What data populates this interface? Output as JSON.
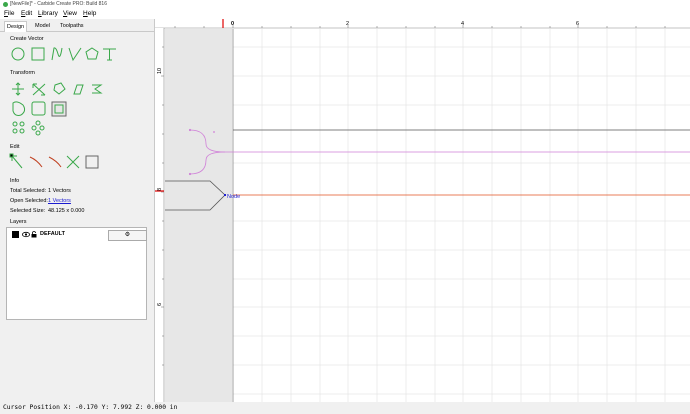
{
  "window": {
    "title": "[NewFile]* - Carbide Create PRO: Build 816"
  },
  "menu": [
    "File",
    "Edit",
    "Library",
    "View",
    "Help"
  ],
  "tabs": [
    "Design",
    "Model",
    "Toolpaths"
  ],
  "sections": {
    "create_vector": "Create Vector",
    "transform": "Transform",
    "edit": "Edit",
    "info": "Info",
    "layers": "Layers"
  },
  "info": {
    "total_selected_label": "Total Selected:",
    "total_selected_value": "1 Vectors",
    "open_selected_label": "Open Selected:",
    "open_selected_value": "1 Vectors",
    "selected_size_label": "Selected Size:",
    "selected_size_value": "48.125 x 0.000"
  },
  "layers": [
    {
      "name": "DEFAULT",
      "color": "#000000"
    }
  ],
  "canvas": {
    "ruler_top_labels": [
      "0",
      "2",
      "4",
      "6"
    ],
    "ruler_left_labels": [
      "10",
      "8",
      "6"
    ],
    "node_label": "Node"
  },
  "status": {
    "text": "Cursor Position X: -0.170 Y: 7.992 Z: 0.000 in"
  },
  "colors": {
    "tool_green": "#3aa84a",
    "selected_vector": "#e05020",
    "vector_pink": "#d080d8",
    "node_blue": "#2020d0"
  }
}
